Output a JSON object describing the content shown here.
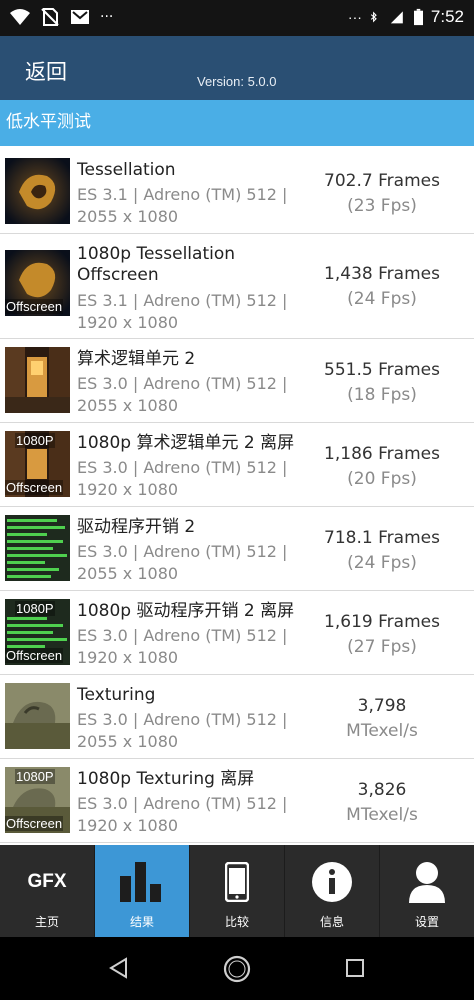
{
  "statusbar": {
    "time": "7:52",
    "left_icons": [
      "wifi-icon",
      "no-sim-icon",
      "gmail-icon",
      "more-notifications-icon"
    ],
    "right_icons": [
      "more-icon",
      "bluetooth-icon",
      "signal-icon",
      "battery-icon"
    ],
    "more_glyph": "···"
  },
  "header": {
    "back_label": "返回",
    "version": "Version: 5.0.0",
    "background": "#2a4f73"
  },
  "section": {
    "title": "低水平测试",
    "background": "#4aaee6"
  },
  "tests": [
    {
      "title": "Tessellation",
      "detail": "ES 3.1 | Adreno (TM) 512 | 2055 x 1080",
      "line1": "ES 3.1 | Adreno (TM) 512 |",
      "line2": "2055 x 1080",
      "score": "702.7 Frames",
      "score2": "(23 Fps)",
      "badge_top": "",
      "badge_bottom": ""
    },
    {
      "title": "1080p Tessellation Offscreen",
      "line1": "ES 3.1 | Adreno (TM) 512 |",
      "line2": "1920 x 1080",
      "score": "1,438 Frames",
      "score2": "(24 Fps)",
      "badge_top": "",
      "badge_bottom": "Offscreen"
    },
    {
      "title": "算术逻辑单元 2",
      "line1": "ES 3.0 | Adreno (TM) 512 |",
      "line2": "2055 x 1080",
      "score": "551.5 Frames",
      "score2": "(18 Fps)",
      "badge_top": "",
      "badge_bottom": ""
    },
    {
      "title": "1080p 算术逻辑单元 2 离屏",
      "line1": "ES 3.0 | Adreno (TM) 512 |",
      "line2": "1920 x 1080",
      "score": "1,186 Frames",
      "score2": "(20 Fps)",
      "badge_top": "1080P",
      "badge_bottom": "Offscreen"
    },
    {
      "title": "驱动程序开销 2",
      "line1": "ES 3.0 | Adreno (TM) 512 |",
      "line2": "2055 x 1080",
      "score": "718.1 Frames",
      "score2": "(24 Fps)",
      "badge_top": "",
      "badge_bottom": ""
    },
    {
      "title": "1080p 驱动程序开销 2 离屏",
      "line1": "ES 3.0 | Adreno (TM) 512 |",
      "line2": "1920 x 1080",
      "score": "1,619 Frames",
      "score2": "(27 Fps)",
      "badge_top": "1080P",
      "badge_bottom": "Offscreen"
    },
    {
      "title": "Texturing",
      "line1": "ES 3.0 | Adreno (TM) 512 |",
      "line2": "2055 x 1080",
      "score": "3,798",
      "score2": "MTexel/s",
      "badge_top": "",
      "badge_bottom": ""
    },
    {
      "title": "1080p Texturing 离屏",
      "line1": "ES 3.0 | Adreno (TM) 512 |",
      "line2": "1920 x 1080",
      "score": "3,826",
      "score2": "MTexel/s",
      "badge_top": "1080P",
      "badge_bottom": "Offscreen"
    }
  ],
  "tabs": [
    {
      "label": "主页",
      "icon": "gfx-logo-icon",
      "icon_text": "GFX"
    },
    {
      "label": "结果",
      "icon": "bar-chart-icon",
      "active": true
    },
    {
      "label": "比较",
      "icon": "phone-icon"
    },
    {
      "label": "信息",
      "icon": "info-icon"
    },
    {
      "label": "设置",
      "icon": "user-icon"
    }
  ],
  "colors": {
    "tab_active": "#3d97d6",
    "tab_bar": "#2b2b2b"
  }
}
